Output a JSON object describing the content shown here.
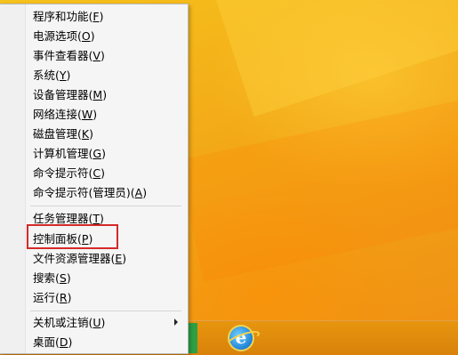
{
  "menu": {
    "items": [
      {
        "label": "程序和功能(",
        "key": "F",
        "tail": ")"
      },
      {
        "label": "电源选项(",
        "key": "O",
        "tail": ")"
      },
      {
        "label": "事件查看器(",
        "key": "V",
        "tail": ")"
      },
      {
        "label": "系统(",
        "key": "Y",
        "tail": ")"
      },
      {
        "label": "设备管理器(",
        "key": "M",
        "tail": ")"
      },
      {
        "label": "网络连接(",
        "key": "W",
        "tail": ")"
      },
      {
        "label": "磁盘管理(",
        "key": "K",
        "tail": ")"
      },
      {
        "label": "计算机管理(",
        "key": "G",
        "tail": ")"
      },
      {
        "label": "命令提示符(",
        "key": "C",
        "tail": ")"
      },
      {
        "label": "命令提示符(管理员)(",
        "key": "A",
        "tail": ")"
      },
      {
        "label": "任务管理器(",
        "key": "T",
        "tail": ")"
      },
      {
        "label": "控制面板(",
        "key": "P",
        "tail": ")"
      },
      {
        "label": "文件资源管理器(",
        "key": "E",
        "tail": ")"
      },
      {
        "label": "搜索(",
        "key": "S",
        "tail": ")"
      },
      {
        "label": "运行(",
        "key": "R",
        "tail": ")"
      },
      {
        "label": "关机或注销(",
        "key": "U",
        "tail": ")"
      },
      {
        "label": "桌面(",
        "key": "D",
        "tail": ")"
      }
    ]
  },
  "taskbar": {
    "ie_glyph": "e"
  },
  "colors": {
    "highlight": "#d42a2a",
    "desktop": "#f3a817"
  }
}
